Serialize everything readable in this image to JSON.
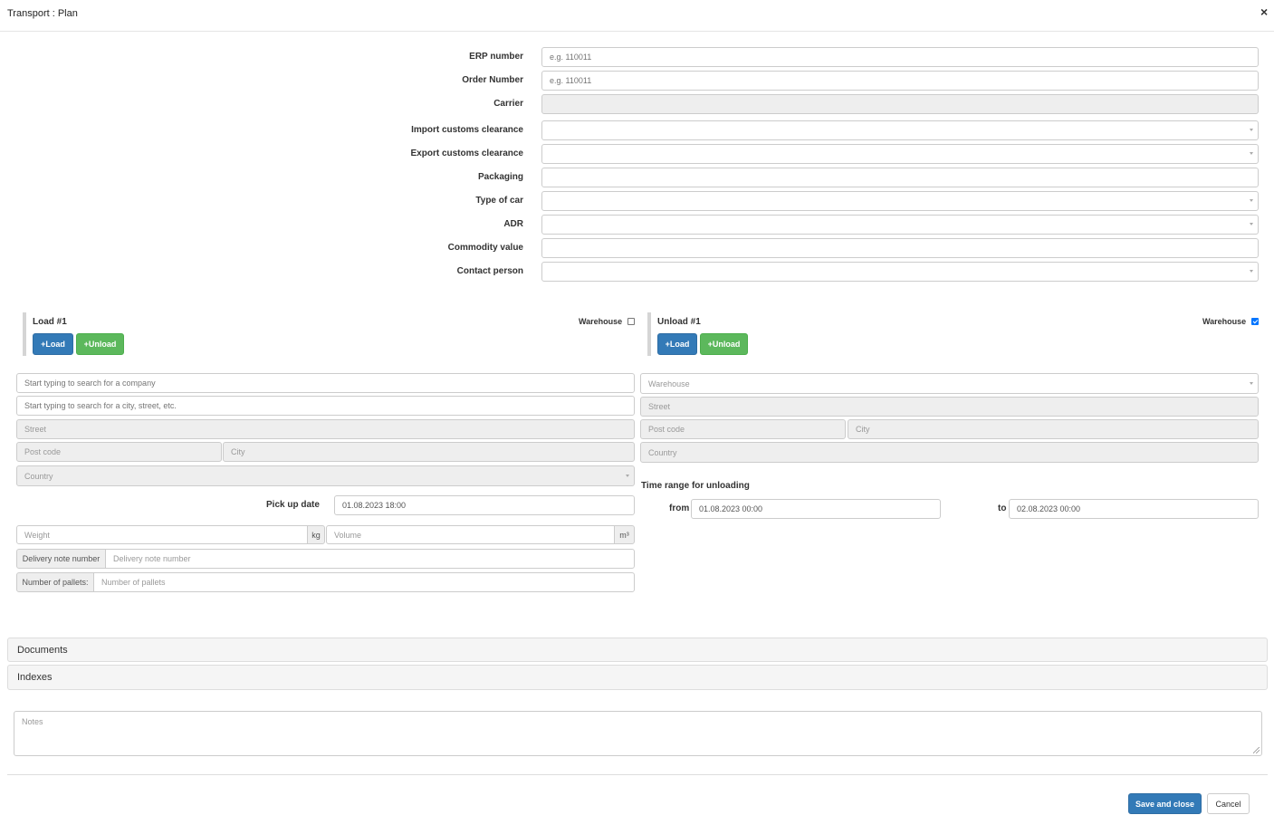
{
  "window": {
    "title": "Transport : Plan",
    "close_symbol": "×"
  },
  "form": {
    "erp_number": {
      "label": "ERP number",
      "placeholder": "e.g. 110011",
      "value": ""
    },
    "order_number": {
      "label": "Order Number",
      "placeholder": "e.g. 110011",
      "value": ""
    },
    "carrier": {
      "label": "Carrier",
      "value": ""
    },
    "import_customs": {
      "label": "Import customs clearance",
      "value": ""
    },
    "export_customs": {
      "label": "Export customs clearance",
      "value": ""
    },
    "packaging": {
      "label": "Packaging",
      "value": ""
    },
    "type_of_car": {
      "label": "Type of car",
      "value": ""
    },
    "adr": {
      "label": "ADR",
      "value": ""
    },
    "commodity_value": {
      "label": "Commodity value",
      "value": ""
    },
    "contact_person": {
      "label": "Contact person",
      "value": ""
    }
  },
  "load": {
    "title": "Load #1",
    "warehouse_label": "Warehouse",
    "warehouse_checked": false,
    "add_load_label": "+Load",
    "add_unload_label": "+Unload",
    "company_placeholder": "Start typing to search for a company",
    "address_placeholder": "Start typing to search for a city, street, etc.",
    "street_placeholder": "Street",
    "postcode_placeholder": "Post code",
    "city_placeholder": "City",
    "country_placeholder": "Country",
    "pickup_label": "Pick up date",
    "pickup_value": "01.08.2023 18:00",
    "weight_placeholder": "Weight",
    "weight_unit": "kg",
    "volume_placeholder": "Volume",
    "volume_unit": "m³",
    "delivery_note_label": "Delivery note number",
    "delivery_note_placeholder": "Delivery note number",
    "pallets_label": "Number of pallets:",
    "pallets_placeholder": "Number of pallets"
  },
  "unload": {
    "title": "Unload #1",
    "warehouse_label": "Warehouse",
    "warehouse_checked": true,
    "add_load_label": "+Load",
    "add_unload_label": "+Unload",
    "warehouse_select_placeholder": "Warehouse",
    "street_placeholder": "Street",
    "postcode_placeholder": "Post code",
    "city_placeholder": "City",
    "country_placeholder": "Country",
    "time_range_label": "Time range for unloading",
    "from_label": "from",
    "from_value": "01.08.2023 00:00",
    "to_label": "to",
    "to_value": "02.08.2023 00:00"
  },
  "panels": {
    "documents": "Documents",
    "indexes": "Indexes"
  },
  "notes": {
    "placeholder": "Notes"
  },
  "footer": {
    "save_label": "Save and close",
    "cancel_label": "Cancel"
  },
  "colors": {
    "primary": "#337ab7",
    "success": "#5cb85c",
    "readonly_bg": "#eeeeee",
    "border": "#cccccc"
  }
}
